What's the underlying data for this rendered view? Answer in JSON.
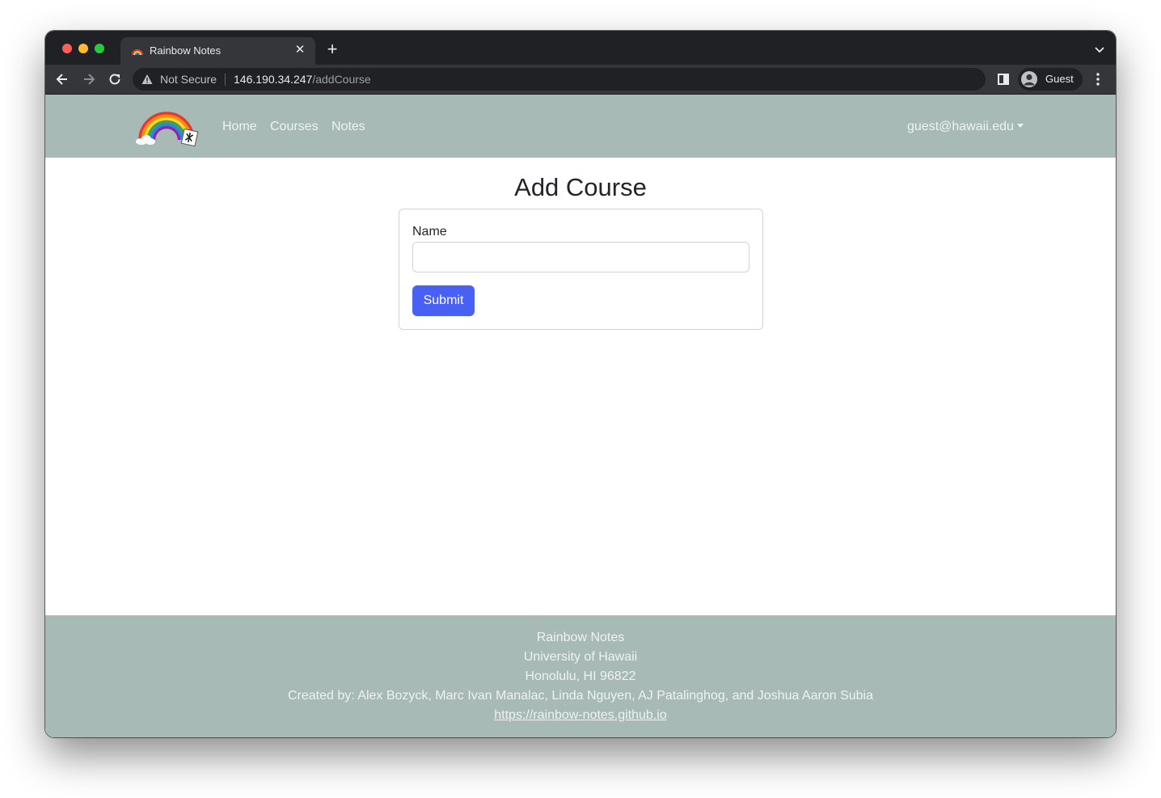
{
  "browser": {
    "tab_title": "Rainbow Notes",
    "security_label": "Not Secure",
    "url_host": "146.190.34.247",
    "url_path": "/addCourse",
    "profile_label": "Guest"
  },
  "navbar": {
    "links": [
      "Home",
      "Courses",
      "Notes"
    ],
    "user_email": "guest@hawaii.edu"
  },
  "main": {
    "title": "Add Course",
    "form": {
      "name_label": "Name",
      "name_value": "",
      "submit_label": "Submit"
    }
  },
  "footer": {
    "lines": [
      "Rainbow Notes",
      "University of Hawaii",
      "Honolulu, HI 96822",
      "Created by: Alex Bozyck, Marc Ivan Manalac, Linda Nguyen, AJ Patalinghog, and Joshua Aaron Subia"
    ],
    "link": "https://rainbow-notes.github.io"
  },
  "colors": {
    "navbar_bg": "#a7bab5",
    "primary_button": "#4960f5",
    "browser_chrome": "#202124"
  }
}
